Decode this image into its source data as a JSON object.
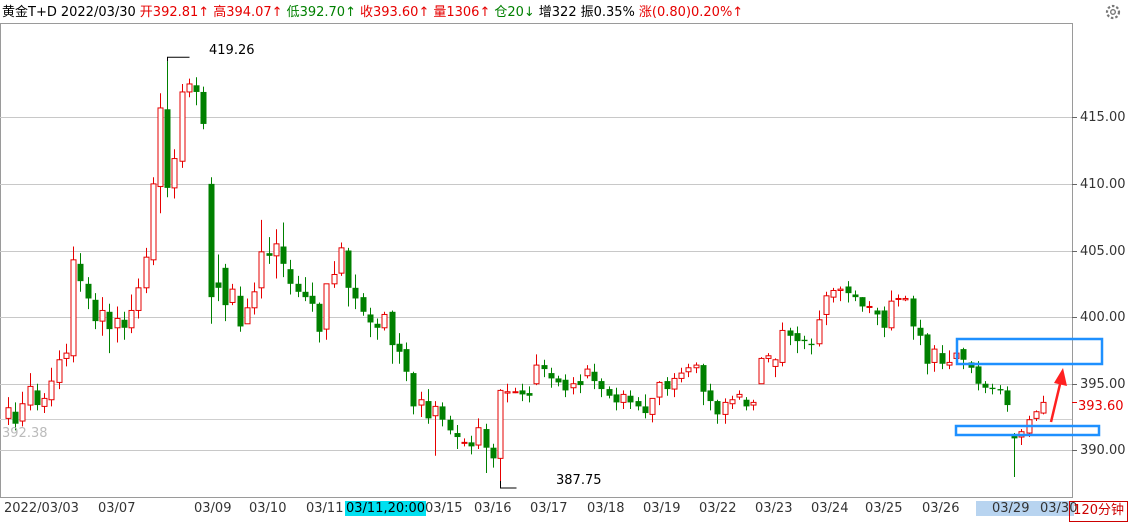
{
  "header": {
    "symbol": "黄金T+D",
    "date": "2022/03/30",
    "open": "开392.81↑",
    "high": "高394.07↑",
    "low": "低392.70↑",
    "close": "收393.60↑",
    "volume": "量1306↑",
    "position": "仓20↓",
    "increase": "增322",
    "amplitude": "振0.35%",
    "change": "涨(0.80)0.20%↑"
  },
  "period_label": "120分钟",
  "last_price_label": "393.60",
  "left_price_label": "392.38",
  "annotations": {
    "high_label": "419.26",
    "low_label": "387.75"
  },
  "x_labels": {
    "first": "2022/03/03",
    "d0307": "03/07",
    "d0309": "03/09",
    "d0310": "03/10",
    "d0311": "03/11",
    "d0311_cursor": "03/11,20:00",
    "d0315": "03/15",
    "d0316": "03/16",
    "d0317": "03/17",
    "d0318": "03/18",
    "d0319": "03/19",
    "d0322": "03/22",
    "d0323": "03/23",
    "d0324": "03/24",
    "d0325": "03/25",
    "d0326": "03/26",
    "d0329": "03/29",
    "d0330": "03/30"
  },
  "colors": {
    "up": "#e60000",
    "down": "#008000",
    "box": "#1e90ff",
    "arrow": "#ff2020",
    "grid": "#c8c8c8"
  },
  "chart_data": {
    "type": "candlestick",
    "title": "黄金T+D",
    "ylim": [
      386.5,
      422
    ],
    "yticks": [
      390,
      395,
      400,
      405,
      410,
      415
    ],
    "y_tick_labels": [
      "390.00",
      "395.00",
      "400.00",
      "405.00",
      "410.00",
      "415.00"
    ],
    "reference_level": 392.38,
    "highest": 419.26,
    "lowest": 387.75,
    "last": 393.6,
    "candles": [
      [
        392.4,
        393.2,
        391.9,
        394.0
      ],
      [
        392.9,
        392.0,
        391.5,
        393.6
      ],
      [
        392.2,
        393.5,
        391.8,
        394.4
      ],
      [
        393.4,
        394.8,
        393.0,
        395.8
      ],
      [
        394.5,
        393.4,
        393.0,
        395.0
      ],
      [
        393.3,
        393.9,
        392.8,
        394.3
      ],
      [
        393.8,
        395.2,
        393.3,
        396.2
      ],
      [
        395.1,
        396.8,
        394.6,
        397.5
      ],
      [
        396.9,
        397.3,
        396.3,
        398.0
      ],
      [
        397.1,
        404.3,
        396.6,
        405.3
      ],
      [
        404.0,
        402.7,
        401.9,
        404.8
      ],
      [
        402.5,
        401.4,
        400.6,
        403.0
      ],
      [
        401.3,
        399.7,
        399.1,
        401.8
      ],
      [
        399.7,
        400.5,
        398.6,
        401.5
      ],
      [
        400.4,
        399.1,
        397.3,
        401.0
      ],
      [
        399.2,
        399.9,
        398.1,
        400.8
      ],
      [
        399.8,
        399.2,
        398.3,
        400.4
      ],
      [
        399.2,
        400.5,
        398.8,
        401.7
      ],
      [
        400.5,
        402.2,
        399.9,
        402.9
      ],
      [
        402.2,
        404.5,
        401.8,
        405.2
      ],
      [
        404.3,
        410.0,
        403.9,
        410.5
      ],
      [
        409.8,
        415.7,
        407.8,
        416.8
      ],
      [
        415.6,
        409.7,
        409.0,
        419.2
      ],
      [
        409.7,
        411.9,
        408.9,
        412.6
      ],
      [
        411.7,
        416.9,
        411.2,
        417.5
      ],
      [
        416.9,
        417.5,
        416.5,
        417.9
      ],
      [
        417.4,
        416.9,
        415.9,
        418.0
      ],
      [
        416.9,
        414.5,
        414.1,
        417.3
      ],
      [
        410.0,
        401.5,
        399.5,
        410.5
      ],
      [
        402.6,
        402.2,
        401.2,
        404.7
      ],
      [
        403.7,
        400.9,
        399.7,
        404.0
      ],
      [
        401.1,
        402.1,
        400.9,
        402.5
      ],
      [
        401.6,
        399.3,
        398.9,
        402.3
      ],
      [
        399.5,
        400.7,
        399.6,
        401.4
      ],
      [
        400.7,
        401.9,
        400.2,
        402.6
      ],
      [
        402.2,
        404.9,
        401.4,
        407.3
      ],
      [
        404.8,
        404.6,
        404.0,
        406.0
      ],
      [
        404.6,
        405.5,
        402.9,
        406.6
      ],
      [
        405.3,
        404.0,
        403.0,
        407.1
      ],
      [
        403.6,
        402.5,
        401.7,
        404.3
      ],
      [
        402.5,
        401.9,
        401.5,
        403.1
      ],
      [
        401.9,
        401.5,
        401.2,
        403.0
      ],
      [
        401.6,
        401.0,
        400.4,
        402.6
      ],
      [
        401.0,
        398.9,
        398.1,
        401.1
      ],
      [
        399.1,
        402.5,
        398.3,
        402.5
      ],
      [
        402.5,
        403.2,
        402.2,
        404.2
      ],
      [
        403.3,
        405.2,
        403.1,
        405.6
      ],
      [
        405.0,
        402.2,
        400.8,
        405.2
      ],
      [
        402.2,
        401.4,
        400.6,
        403.2
      ],
      [
        401.5,
        400.4,
        400.1,
        401.8
      ],
      [
        400.2,
        399.6,
        398.5,
        400.7
      ],
      [
        399.5,
        399.2,
        398.3,
        399.9
      ],
      [
        399.2,
        400.2,
        399.0,
        400.4
      ],
      [
        400.4,
        397.9,
        396.5,
        400.5
      ],
      [
        398.0,
        397.4,
        396.5,
        398.8
      ],
      [
        397.6,
        395.9,
        395.2,
        398.1
      ],
      [
        395.8,
        393.3,
        392.7,
        395.9
      ],
      [
        393.4,
        393.8,
        392.5,
        394.4
      ],
      [
        393.7,
        392.4,
        392.0,
        394.6
      ],
      [
        392.6,
        393.3,
        389.6,
        393.7
      ],
      [
        393.3,
        392.3,
        391.8,
        393.6
      ],
      [
        392.3,
        391.5,
        391.2,
        392.6
      ],
      [
        391.3,
        391.0,
        390.1,
        391.9
      ],
      [
        390.6,
        390.6,
        390.3,
        390.9
      ],
      [
        390.6,
        390.3,
        389.7,
        391.1
      ],
      [
        390.4,
        391.7,
        390.1,
        392.4
      ],
      [
        391.6,
        390.2,
        388.3,
        392.0
      ],
      [
        390.2,
        389.4,
        388.7,
        390.5
      ],
      [
        389.4,
        394.5,
        387.7,
        394.6
      ],
      [
        394.3,
        394.4,
        393.6,
        395.0
      ],
      [
        394.4,
        394.4,
        394.3,
        394.7
      ],
      [
        394.5,
        394.2,
        393.7,
        395.0
      ],
      [
        394.3,
        394.1,
        393.6,
        394.8
      ],
      [
        395.0,
        396.4,
        394.9,
        397.2
      ],
      [
        396.4,
        396.1,
        395.5,
        396.8
      ],
      [
        395.8,
        395.4,
        394.7,
        396.2
      ],
      [
        395.4,
        395.1,
        394.8,
        395.6
      ],
      [
        395.3,
        394.5,
        394.0,
        395.7
      ],
      [
        394.7,
        395.0,
        394.2,
        395.5
      ],
      [
        395.2,
        394.9,
        394.3,
        395.7
      ],
      [
        395.6,
        396.1,
        395.4,
        396.4
      ],
      [
        395.9,
        395.2,
        394.6,
        396.5
      ],
      [
        395.2,
        394.6,
        394.0,
        395.4
      ],
      [
        394.6,
        394.1,
        393.9,
        394.8
      ],
      [
        394.2,
        393.6,
        393.0,
        394.7
      ],
      [
        393.6,
        394.2,
        393.1,
        394.5
      ],
      [
        394.1,
        393.6,
        393.1,
        394.5
      ],
      [
        393.7,
        393.3,
        393.0,
        394.0
      ],
      [
        393.3,
        392.8,
        392.4,
        394.2
      ],
      [
        392.7,
        393.9,
        392.1,
        393.9
      ],
      [
        394.0,
        395.1,
        393.4,
        395.2
      ],
      [
        395.2,
        394.6,
        394.1,
        395.5
      ],
      [
        394.6,
        395.4,
        394.0,
        395.8
      ],
      [
        395.4,
        395.8,
        395.1,
        396.2
      ],
      [
        395.9,
        396.2,
        395.5,
        396.5
      ],
      [
        396.2,
        396.4,
        395.8,
        396.6
      ],
      [
        396.4,
        394.4,
        393.4,
        396.5
      ],
      [
        394.5,
        393.7,
        393.0,
        395.0
      ],
      [
        393.7,
        392.7,
        392.0,
        393.8
      ],
      [
        392.7,
        393.6,
        392.0,
        393.9
      ],
      [
        393.5,
        393.8,
        393.1,
        394.1
      ],
      [
        394.0,
        394.2,
        393.8,
        394.5
      ],
      [
        393.8,
        393.3,
        393.0,
        394.0
      ],
      [
        393.4,
        393.6,
        393.0,
        393.8
      ],
      [
        395.0,
        396.9,
        395.0,
        397.0
      ],
      [
        396.9,
        397.1,
        396.6,
        397.3
      ],
      [
        396.3,
        396.8,
        395.5,
        396.9
      ],
      [
        396.6,
        399.0,
        396.3,
        399.6
      ],
      [
        399.0,
        398.6,
        397.9,
        399.2
      ],
      [
        398.8,
        398.2,
        397.3,
        399.3
      ],
      [
        398.3,
        398.2,
        397.6,
        398.6
      ],
      [
        398.0,
        397.9,
        397.2,
        398.4
      ],
      [
        398.0,
        399.8,
        397.8,
        400.5
      ],
      [
        400.2,
        401.6,
        399.4,
        401.9
      ],
      [
        401.5,
        402.0,
        401.1,
        402.2
      ],
      [
        402.0,
        402.1,
        401.2,
        402.3
      ],
      [
        402.3,
        401.8,
        401.1,
        402.7
      ],
      [
        401.7,
        401.5,
        401.2,
        402.0
      ],
      [
        401.5,
        400.8,
        400.4,
        401.5
      ],
      [
        400.8,
        400.8,
        400.3,
        401.2
      ],
      [
        400.5,
        400.2,
        399.4,
        400.7
      ],
      [
        400.5,
        399.2,
        398.5,
        400.8
      ],
      [
        399.2,
        401.2,
        399.0,
        402.0
      ],
      [
        401.4,
        401.4,
        400.8,
        401.7
      ],
      [
        401.3,
        401.4,
        401.2,
        401.6
      ],
      [
        401.4,
        399.3,
        398.3,
        401.6
      ],
      [
        399.2,
        398.6,
        397.9,
        399.8
      ],
      [
        398.7,
        396.5,
        395.7,
        398.8
      ],
      [
        396.6,
        397.6,
        395.9,
        397.9
      ],
      [
        397.3,
        396.5,
        396.1,
        397.9
      ],
      [
        396.4,
        396.6,
        396.1,
        397.5
      ],
      [
        396.9,
        397.3,
        396.6,
        397.5
      ],
      [
        397.6,
        396.8,
        396.1,
        397.7
      ],
      [
        396.6,
        396.2,
        395.8,
        396.7
      ],
      [
        396.3,
        395.0,
        394.5,
        396.7
      ],
      [
        395.0,
        394.7,
        394.3,
        395.2
      ],
      [
        394.7,
        394.6,
        394.2,
        395.0
      ],
      [
        394.6,
        394.5,
        394.2,
        394.9
      ],
      [
        394.5,
        393.4,
        392.9,
        394.8
      ],
      [
        391.2,
        390.9,
        388.0,
        391.3
      ],
      [
        391.0,
        391.4,
        390.4,
        391.6
      ],
      [
        391.3,
        392.3,
        391.0,
        392.6
      ],
      [
        392.4,
        392.9,
        392.2,
        393.0
      ],
      [
        392.8,
        393.6,
        392.7,
        394.1
      ]
    ]
  }
}
